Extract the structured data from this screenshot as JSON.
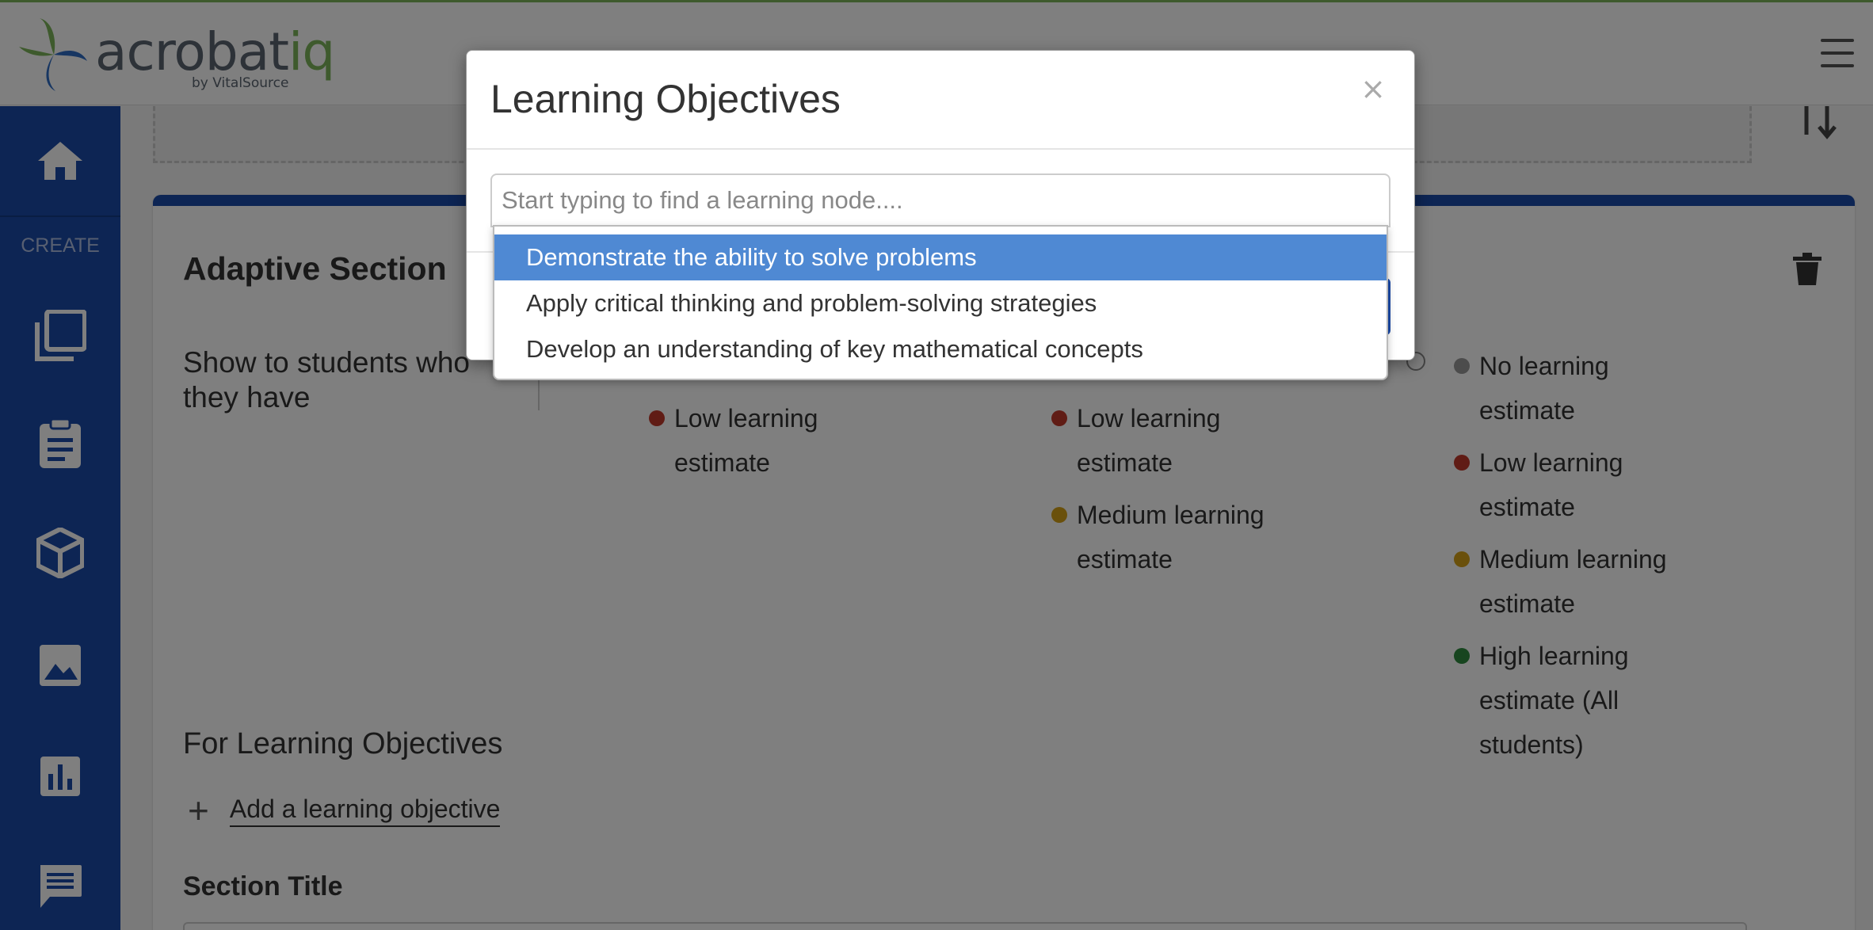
{
  "header": {
    "logo_main": "acrobat",
    "logo_iq": "iq",
    "logo_by": "by VitalSource"
  },
  "sidebar": {
    "create_label": "CREATE",
    "items": [
      "home-icon",
      "pages-icon",
      "clipboard-icon",
      "cube-icon",
      "image-icon",
      "chart-icon",
      "comment-icon"
    ]
  },
  "card": {
    "title": "Adaptive Section",
    "show_label": "Show to students who they have",
    "columns": [
      {
        "items": [
          {
            "label": "Low learning estimate",
            "color": "#c0392b"
          }
        ]
      },
      {
        "items": [
          {
            "label": "Low learning estimate",
            "color": "#c0392b"
          },
          {
            "label": "Medium learning estimate",
            "color": "#d4a017"
          }
        ]
      },
      {
        "items": [
          {
            "label": "No learning estimate",
            "color": "#999999"
          },
          {
            "label": "Low learning estimate",
            "color": "#c0392b"
          },
          {
            "label": "Medium learning estimate",
            "color": "#d4a017"
          },
          {
            "label": "High learning estimate (All students)",
            "color": "#2e8b3e"
          }
        ]
      }
    ],
    "lo_heading": "For Learning Objectives",
    "add_lo_label": "Add a learning objective",
    "section_title_label": "Section Title"
  },
  "modal": {
    "title": "Learning Objectives",
    "close": "×",
    "search_placeholder": "Start typing to find a learning node....",
    "options": [
      {
        "label": "Demonstrate the ability to solve problems",
        "active": true
      },
      {
        "label": "Apply critical thinking and problem-solving strategies",
        "active": false
      },
      {
        "label": "Develop an understanding of key mathematical concepts",
        "active": false
      }
    ]
  },
  "colors": {
    "sidebar": "#1a4aa8",
    "brand_green": "#7cb55a",
    "highlight": "#4f89d3"
  }
}
